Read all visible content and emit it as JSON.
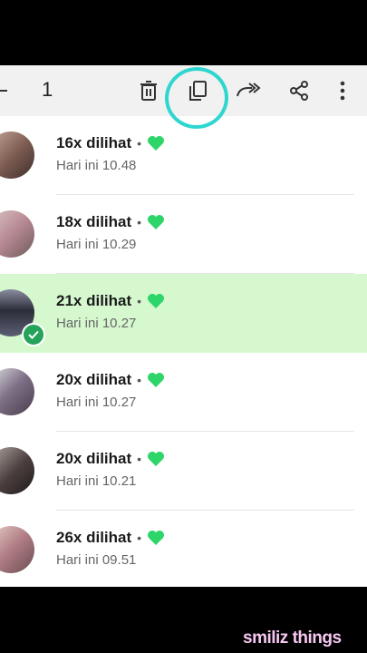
{
  "toolbar": {
    "selected_count": "1",
    "icons": [
      "back-arrow-icon",
      "trash-icon",
      "copy-icon",
      "forward-icon",
      "share-icon",
      "more-vert-icon"
    ]
  },
  "accent_colors": {
    "heart": "#2ed66a",
    "selected_bg": "#d6f8cf",
    "highlight": "#2fd6d0"
  },
  "rows": [
    {
      "views": "16x dilihat",
      "sep": "•",
      "time": "Hari ini 10.48",
      "selected": false
    },
    {
      "views": "18x dilihat",
      "sep": "•",
      "time": "Hari ini 10.29",
      "selected": false
    },
    {
      "views": "21x dilihat",
      "sep": "•",
      "time": "Hari ini 10.27",
      "selected": true
    },
    {
      "views": "20x dilihat",
      "sep": "•",
      "time": "Hari ini 10.27",
      "selected": false
    },
    {
      "views": "20x dilihat",
      "sep": "•",
      "time": "Hari ini 10.21",
      "selected": false
    },
    {
      "views": "26x dilihat",
      "sep": "•",
      "time": "Hari ini 09.51",
      "selected": false
    }
  ],
  "watermark": "smiliz things"
}
